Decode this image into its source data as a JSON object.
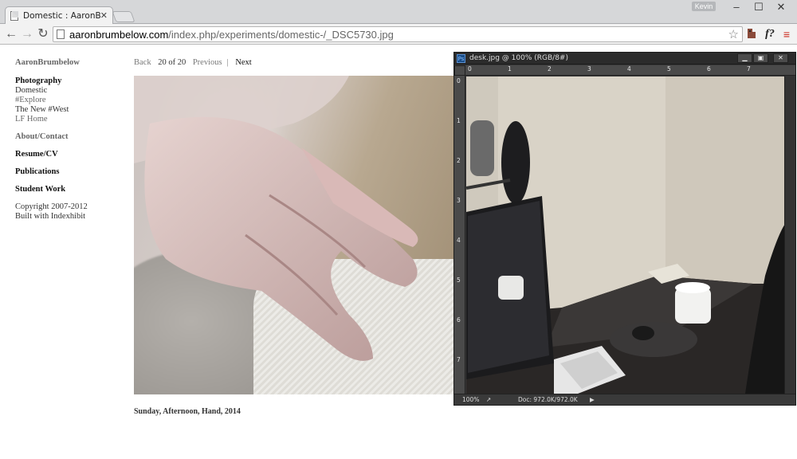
{
  "browser": {
    "tab_title": "Domestic : AaronBrumbelow",
    "tab_close": "✕",
    "profile_name": "Kevin",
    "window_controls": {
      "minimize": "–",
      "maximize": "☐",
      "close": "✕"
    },
    "url_host": "aaronbrumbelow.com",
    "url_path": "/index.php/experiments/domestic-/_DSC5730.jpg",
    "nav": {
      "back": "←",
      "forward": "→",
      "reload": "↻"
    },
    "toolbar_icons": [
      "star-icon",
      "extension-icon",
      "formula-extension-icon",
      "menu-icon"
    ],
    "formula_label": "f?",
    "menu_label": "≡"
  },
  "sidebar": {
    "site_name": "AaronBrumbelow",
    "sections": [
      {
        "heading": "Photography",
        "links": [
          "Domestic",
          "#Explore",
          "The New #West",
          "LF Home"
        ]
      },
      {
        "heading": "",
        "links": [
          "About/Contact"
        ]
      },
      {
        "heading": "Resume/CV",
        "links": []
      },
      {
        "heading": "Publications",
        "links": []
      },
      {
        "heading": "Student Work",
        "links": []
      }
    ],
    "footer": [
      "Copyright 2007-2012",
      "Built with Indexhibit"
    ]
  },
  "pager": {
    "back": "Back",
    "position": "20 of 20",
    "previous": "Previous",
    "separator": "|",
    "next": "Next"
  },
  "caption": "Sunday, Afternoon, Hand, 2014",
  "photoshop": {
    "badge": "Ps",
    "doc_title": "desk.jpg @ 100% (RGB/8#)",
    "ruler_top": [
      "0",
      "1",
      "2",
      "3",
      "4",
      "5",
      "6",
      "7"
    ],
    "ruler_left": [
      "0",
      "1",
      "2",
      "3",
      "4",
      "5",
      "6",
      "7"
    ],
    "zoom": "100%",
    "doc_info": "Doc: 972.0K/972.0K"
  },
  "colors": {
    "page_bg": "#ffffff",
    "ps_chrome": "#3a3a3a",
    "chrome_frame": "#d6d7d9"
  }
}
